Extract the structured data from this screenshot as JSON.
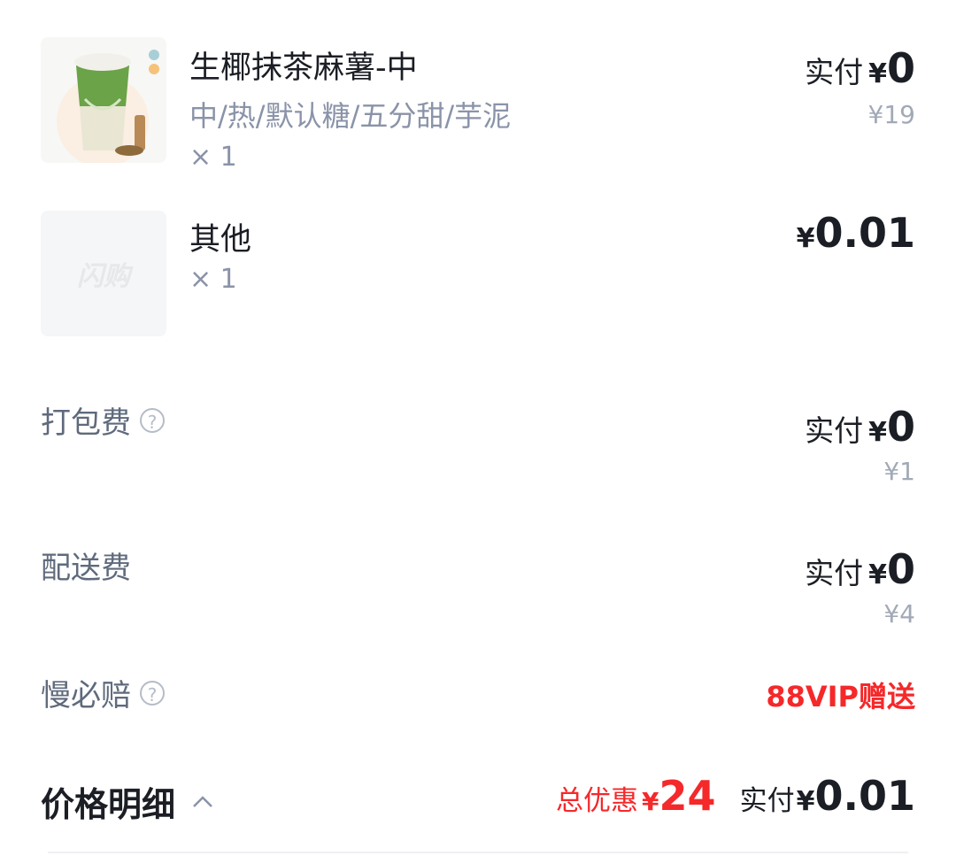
{
  "items": [
    {
      "name": "生椰抹茶麻薯-中",
      "spec": "中/热/默认糖/五分甜/芋泥",
      "qty": "× 1",
      "paid_label": "实付",
      "paid_currency": "¥",
      "paid_value": "0",
      "original_price": "¥19"
    },
    {
      "name": "其他",
      "qty": "× 1",
      "thumb_placeholder": "闪购",
      "price_currency": "¥",
      "price_value": "0.01"
    }
  ],
  "fees": {
    "packing": {
      "label": "打包费",
      "paid_label": "实付",
      "paid_currency": "¥",
      "paid_value": "0",
      "original_price": "¥1"
    },
    "delivery": {
      "label": "配送费",
      "paid_label": "实付",
      "paid_currency": "¥",
      "paid_value": "0",
      "original_price": "¥4"
    },
    "late_compensation": {
      "label": "慢必赔",
      "value": "88VIP赠送"
    }
  },
  "price_detail": {
    "label": "价格明细",
    "discount_label": "总优惠",
    "discount_currency": "¥",
    "discount_value": "24",
    "paid_label": "实付",
    "paid_currency": "¥",
    "paid_value": "0.01"
  },
  "colors": {
    "accent_red": "#f5282a",
    "text_primary": "#1b1e24",
    "text_secondary": "#8a93a8",
    "matcha_green": "#5f9a3f"
  }
}
